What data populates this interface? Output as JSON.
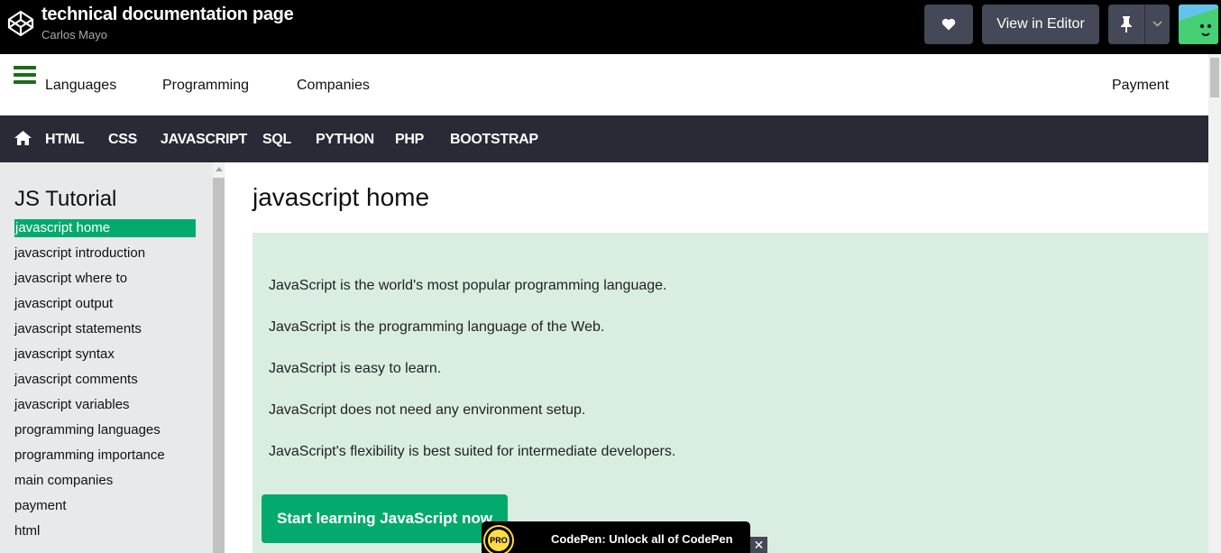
{
  "codepen": {
    "title": "technical documentation page",
    "author": "Carlos Mayo",
    "view_in_editor": "View in Editor",
    "icons": [
      "codepen-logo-icon",
      "heart-icon",
      "pin-icon",
      "chevron-down-icon",
      "avatar"
    ]
  },
  "topnav": {
    "links": [
      "Languages",
      "Programming",
      "Companies",
      "Payment"
    ]
  },
  "catbar": {
    "items": [
      "HTML",
      "CSS",
      "JAVASCRIPT",
      "SQL",
      "PYTHON",
      "PHP",
      "BOOTSTRAP"
    ]
  },
  "sidebar": {
    "title": "JS Tutorial",
    "items": [
      "javascript home",
      "javascript introduction",
      "javascript where to",
      "javascript output",
      "javascript statements",
      "javascript syntax",
      "javascript comments",
      "javascript variables",
      "programming languages",
      "programming importance",
      "main companies",
      "payment",
      "html"
    ],
    "active_index": 0
  },
  "main": {
    "title": "javascript home",
    "paragraphs": [
      "JavaScript is the world's most popular programming language.",
      "JavaScript is the programming language of the Web.",
      "JavaScript is easy to learn.",
      "JavaScript does not need any environment setup.",
      "JavaScript's flexibility is best suited for intermediate developers."
    ],
    "cta": "Start learning JavaScript now"
  },
  "promo": {
    "badge": "PRO",
    "text": "CodePen: Unlock all of CodePen",
    "close": "✕"
  },
  "colors": {
    "accent_green": "#04aa6d",
    "panel_bg": "#d9eee1",
    "dark_bar": "#282a35"
  }
}
